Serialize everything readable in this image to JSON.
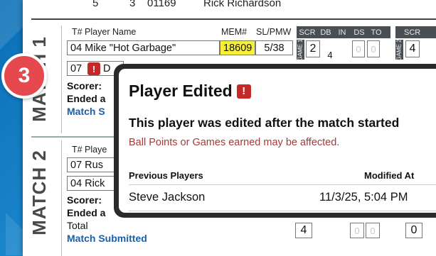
{
  "top_row": {
    "col_a": "5",
    "col_b": "3",
    "col_c": "01169",
    "name": "Rick Richardson"
  },
  "match1": {
    "label": "MATCH 1",
    "headers": {
      "team_num": "T# Player Name",
      "mem": "MEM#",
      "sl": "SL/PMW"
    },
    "score_headers_g1": [
      "SCR",
      "DB",
      "IN",
      "DS",
      "TO"
    ],
    "score_headers_g2": [
      "SCR"
    ],
    "game_tag_1": "GAME 1",
    "game_tag_2": "GAME 2",
    "rows": [
      {
        "player": "04  Mike \"Hot Garbage\"",
        "mem": "18609",
        "sl": "5/38",
        "scr1": "2",
        "db1": "4",
        "in1": "0",
        "ds1": "0",
        "scr2": "4"
      },
      {
        "player": "07",
        "alert": "!",
        "trail": "D"
      }
    ],
    "scorer_label": "Scorer:",
    "ended_label": "Ended a",
    "submitted_label": "Match S"
  },
  "match2": {
    "label": "MATCH 2",
    "headers": {
      "team_num": "T# Playe"
    },
    "rows": [
      {
        "player": "07  Rus"
      },
      {
        "player": "04  Rick"
      }
    ],
    "scorer_label": "Scorer:",
    "ended_label": "Ended a",
    "total_label": "Total",
    "submitted_label": "Match Submitted",
    "total_scores": [
      "4",
      "0",
      "0",
      "0"
    ]
  },
  "step_badge": "3",
  "modal": {
    "title": "Player Edited",
    "alert": "!",
    "subtitle": "This player was edited after the match started",
    "note": "Ball Points or Games earned may be affected.",
    "columns": {
      "previous": "Previous Players",
      "modified": "Modified At"
    },
    "rows": [
      {
        "name": "Steve Jackson",
        "modified": "11/3/25, 5:04 PM"
      }
    ]
  },
  "colors": {
    "accent_red": "#e5484d",
    "mem_highlight": "#f6ef3b",
    "bg_blue": "#1c8ad0",
    "note_red": "#a33a3a",
    "link_blue": "#1a5fa8"
  }
}
